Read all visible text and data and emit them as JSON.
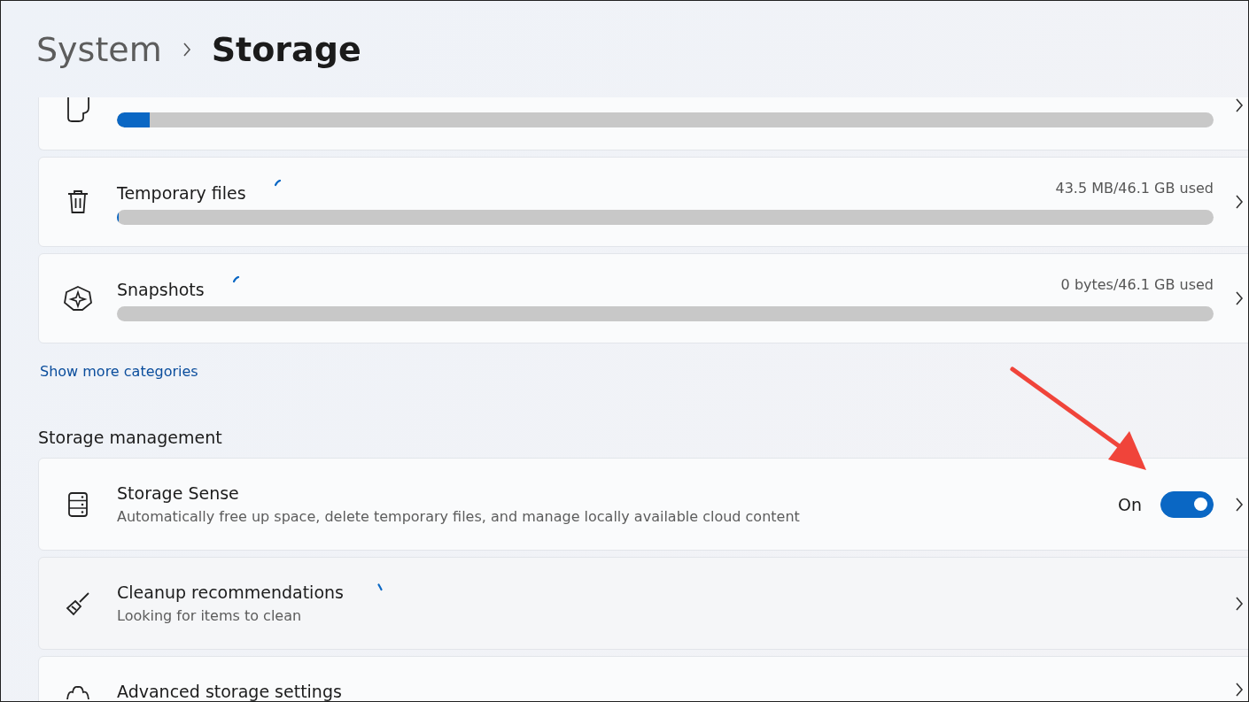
{
  "breadcrumb": {
    "parent": "System",
    "current": "Storage"
  },
  "categories": [
    {
      "level": 0.03,
      "loading": false
    },
    {
      "name": "Temporary files",
      "usage": "43.5 MB/46.1 GB used",
      "level": 0.002,
      "loading": true
    },
    {
      "name": "Snapshots",
      "usage": "0 bytes/46.1 GB used",
      "level": 0,
      "loading": true
    }
  ],
  "show_more_link": "Show more categories",
  "section_title": "Storage management",
  "management": [
    {
      "kind": "toggle",
      "title": "Storage Sense",
      "description": "Automatically free up space, delete temporary files, and manage locally available cloud content",
      "state_label": "On",
      "on": true,
      "loading": false
    },
    {
      "kind": "plain",
      "title": "Cleanup recommendations",
      "description": "Looking for items to clean",
      "loading": true
    },
    {
      "kind": "plain",
      "title": "Advanced storage settings",
      "loading": false
    }
  ]
}
